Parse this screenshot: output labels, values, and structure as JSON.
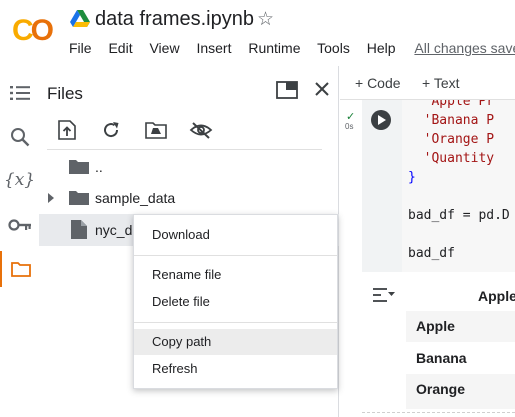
{
  "header": {
    "logo_text_part1": "C",
    "logo_text_part2": "O",
    "notebook_title": "data frames.ipynb",
    "star_glyph": "☆",
    "menu": [
      "File",
      "Edit",
      "View",
      "Insert",
      "Runtime",
      "Tools",
      "Help"
    ],
    "save_status": "All changes saved"
  },
  "rail": {
    "icons": [
      "table-of-contents-icon",
      "search-icon",
      "variables-icon",
      "secrets-key-icon",
      "folder-icon"
    ],
    "variables_glyph": "{x}"
  },
  "files_panel": {
    "title": "Files",
    "toolbar_icons": [
      "upload-icon",
      "refresh-icon",
      "mount-drive-icon",
      "hide-files-icon"
    ],
    "tree": [
      {
        "label": "..",
        "type": "parent-folder"
      },
      {
        "label": "sample_data",
        "type": "folder"
      },
      {
        "label": "nyc_de",
        "type": "file"
      }
    ]
  },
  "context_menu": {
    "items": [
      "Download",
      "Rename file",
      "Delete file",
      "Copy path",
      "Refresh"
    ],
    "hovered": "Copy path"
  },
  "notebook": {
    "toolbar": {
      "add_code": "+ Code",
      "add_text": "+ Text"
    },
    "exec_mark": "✓",
    "exec_time": "0s",
    "code_lines": [
      {
        "text": "  'Apple Pr",
        "cls": "str"
      },
      {
        "text": "  'Banana P",
        "cls": "str"
      },
      {
        "text": "  'Orange P",
        "cls": "str"
      },
      {
        "text": "  'Quantity",
        "cls": "str"
      },
      {
        "text": "}",
        "cls": "kw"
      },
      {
        "text": "",
        "cls": "code"
      },
      {
        "text": "bad_df = pd.D",
        "cls": "code"
      },
      {
        "text": "",
        "cls": "code"
      },
      {
        "text": "bad_df",
        "cls": "code"
      }
    ],
    "output": {
      "column_header": "Apple",
      "rows": [
        "Apple",
        "Banana",
        "Orange"
      ]
    }
  },
  "colors": {
    "accent_orange": "#e8710a",
    "logo_yellow": "#f9ab00",
    "string_red": "#a31515",
    "keyword_blue": "#0000ff",
    "hover_gray": "#ececec",
    "selected_row_gray": "#e8eaed"
  }
}
